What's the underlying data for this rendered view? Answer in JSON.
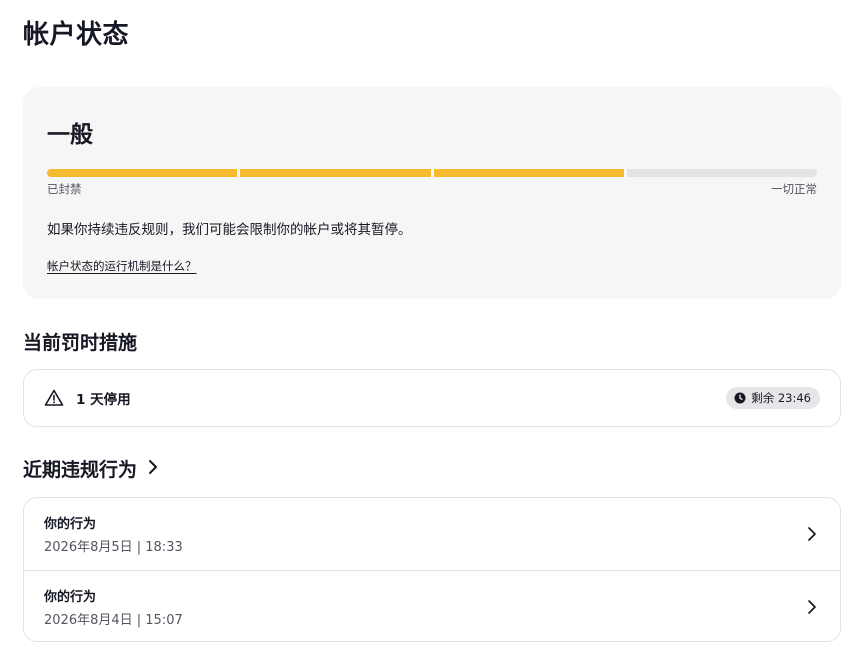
{
  "page": {
    "title": "帐户状态"
  },
  "status": {
    "level": "一般",
    "progress_filled_segments": 3,
    "progress_total_segments": 4,
    "left_label": "已封禁",
    "right_label": "一切正常",
    "warning": "如果你持续违反规则，我们可能会限制你的帐户或将其暂停。",
    "help_link": "帐户状态的运行机制是什么？"
  },
  "penalties": {
    "title": "当前罚时措施",
    "item": {
      "icon": "warning-triangle-icon",
      "label": "1 天停用",
      "badge": "剩余 23:46",
      "badge_icon": "clock-icon"
    }
  },
  "violations": {
    "title": "近期违规行为",
    "items": [
      {
        "title": "你的行为",
        "date": "2026年8月5日 | 18:33"
      },
      {
        "title": "你的行为",
        "date": "2026年8月4日 | 15:07"
      }
    ]
  },
  "colors": {
    "progress_filled": "#f5bb30",
    "progress_empty": "#e3e3e6",
    "card_bg": "#f6f6f6",
    "text": "#161823"
  }
}
